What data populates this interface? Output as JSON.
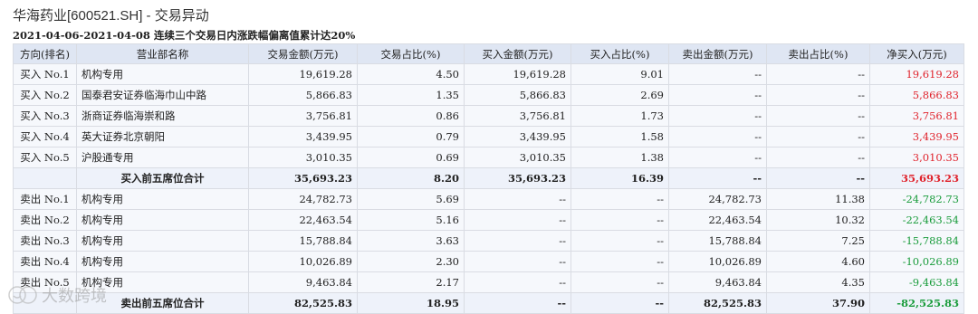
{
  "title": "华海药业[600521.SH] - 交易异动",
  "subtitle": "2021-04-06-2021-04-08 连续三个交易日内涨跌幅偏离值累计达20%",
  "headers": [
    "方向(排名)",
    "营业部名称",
    "交易金额(万元)",
    "交易占比(%)",
    "买入金额(万元)",
    "买入占比(%)",
    "卖出金额(万元)",
    "卖出占比(%)",
    "净买入(万元)"
  ],
  "rows": [
    {
      "rank": "买入 No.1",
      "name": "机构专用",
      "amount": "19,619.28",
      "ratio": "4.50",
      "buy": "19,619.28",
      "buy_ratio": "9.01",
      "sell": "--",
      "sell_ratio": "--",
      "net": "19,619.28",
      "net_sign": "pos",
      "summary": false
    },
    {
      "rank": "买入 No.2",
      "name": "国泰君安证券临海巾山中路",
      "amount": "5,866.83",
      "ratio": "1.35",
      "buy": "5,866.83",
      "buy_ratio": "2.69",
      "sell": "--",
      "sell_ratio": "--",
      "net": "5,866.83",
      "net_sign": "pos",
      "summary": false
    },
    {
      "rank": "买入 No.3",
      "name": "浙商证券临海崇和路",
      "amount": "3,756.81",
      "ratio": "0.86",
      "buy": "3,756.81",
      "buy_ratio": "1.73",
      "sell": "--",
      "sell_ratio": "--",
      "net": "3,756.81",
      "net_sign": "pos",
      "summary": false
    },
    {
      "rank": "买入 No.4",
      "name": "英大证券北京朝阳",
      "amount": "3,439.95",
      "ratio": "0.79",
      "buy": "3,439.95",
      "buy_ratio": "1.58",
      "sell": "--",
      "sell_ratio": "--",
      "net": "3,439.95",
      "net_sign": "pos",
      "summary": false
    },
    {
      "rank": "买入 No.5",
      "name": "沪股通专用",
      "amount": "3,010.35",
      "ratio": "0.69",
      "buy": "3,010.35",
      "buy_ratio": "1.38",
      "sell": "--",
      "sell_ratio": "--",
      "net": "3,010.35",
      "net_sign": "pos",
      "summary": false
    },
    {
      "rank": "",
      "name": "买入前五席位合计",
      "amount": "35,693.23",
      "ratio": "8.20",
      "buy": "35,693.23",
      "buy_ratio": "16.39",
      "sell": "--",
      "sell_ratio": "--",
      "net": "35,693.23",
      "net_sign": "pos",
      "summary": true
    },
    {
      "rank": "卖出 No.1",
      "name": "机构专用",
      "amount": "24,782.73",
      "ratio": "5.69",
      "buy": "--",
      "buy_ratio": "--",
      "sell": "24,782.73",
      "sell_ratio": "11.38",
      "net": "-24,782.73",
      "net_sign": "neg",
      "summary": false
    },
    {
      "rank": "卖出 No.2",
      "name": "机构专用",
      "amount": "22,463.54",
      "ratio": "5.16",
      "buy": "--",
      "buy_ratio": "--",
      "sell": "22,463.54",
      "sell_ratio": "10.32",
      "net": "-22,463.54",
      "net_sign": "neg",
      "summary": false
    },
    {
      "rank": "卖出 No.3",
      "name": "机构专用",
      "amount": "15,788.84",
      "ratio": "3.63",
      "buy": "--",
      "buy_ratio": "--",
      "sell": "15,788.84",
      "sell_ratio": "7.25",
      "net": "-15,788.84",
      "net_sign": "neg",
      "summary": false
    },
    {
      "rank": "卖出 No.4",
      "name": "机构专用",
      "amount": "10,026.89",
      "ratio": "2.30",
      "buy": "--",
      "buy_ratio": "--",
      "sell": "10,026.89",
      "sell_ratio": "4.60",
      "net": "-10,026.89",
      "net_sign": "neg",
      "summary": false
    },
    {
      "rank": "卖出 No.5",
      "name": "机构专用",
      "amount": "9,463.84",
      "ratio": "2.17",
      "buy": "--",
      "buy_ratio": "--",
      "sell": "9,463.84",
      "sell_ratio": "4.35",
      "net": "-9,463.84",
      "net_sign": "neg",
      "summary": false
    },
    {
      "rank": "",
      "name": "卖出前五席位合计",
      "amount": "82,525.83",
      "ratio": "18.95",
      "buy": "--",
      "buy_ratio": "--",
      "sell": "82,525.83",
      "sell_ratio": "37.90",
      "net": "-82,525.83",
      "net_sign": "neg",
      "summary": true
    }
  ],
  "colors": {
    "positive": "#e0232c",
    "negative": "#1a9c3c",
    "header_bg": "#dfe6f3",
    "row_bg": "#f6f8fc"
  },
  "watermark": {
    "icon": "smile-logo-icon",
    "text": "大数跨境"
  }
}
